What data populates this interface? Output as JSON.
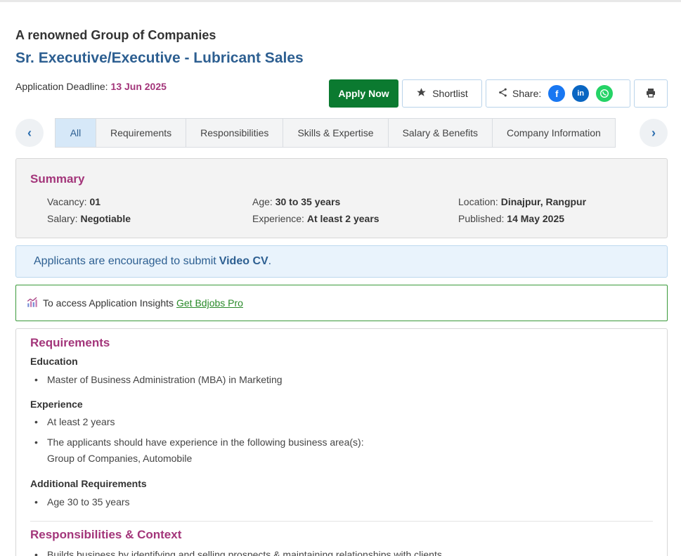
{
  "header": {
    "company": "A renowned Group of Companies",
    "title": "Sr. Executive/Executive - Lubricant Sales",
    "deadline_label": "Application Deadline:",
    "deadline_date": "13 Jun 2025"
  },
  "actions": {
    "apply": "Apply Now",
    "shortlist": "Shortlist",
    "share": "Share:"
  },
  "tabs": [
    "All",
    "Requirements",
    "Responsibilities",
    "Skills & Expertise",
    "Salary & Benefits",
    "Company Information"
  ],
  "summary": {
    "title": "Summary",
    "vacancy_label": "Vacancy:",
    "vacancy": "01",
    "age_label": "Age:",
    "age": "30 to 35 years",
    "location_label": "Location:",
    "location": "Dinajpur, Rangpur",
    "salary_label": "Salary:",
    "salary": "Negotiable",
    "experience_label": "Experience:",
    "experience": "At least 2 years",
    "published_label": "Published:",
    "published": "14 May 2025"
  },
  "notice": {
    "text": "Applicants are encouraged to submit",
    "bold": "Video CV",
    "end": "."
  },
  "insights": {
    "text": "To access Application Insights",
    "link": "Get Bdjobs Pro"
  },
  "requirements": {
    "title": "Requirements",
    "education_title": "Education",
    "education_items": [
      "Master of Business Administration (MBA) in Marketing"
    ],
    "experience_title": "Experience",
    "experience_item1": "At least 2 years",
    "experience_item2_line1": "The applicants should have experience in the following business area(s):",
    "experience_item2_line2": "Group of Companies, Automobile",
    "additional_title": "Additional Requirements",
    "additional_items": [
      "Age 30 to 35 years"
    ]
  },
  "responsibilities": {
    "title": "Responsibilities & Context",
    "first_item": "Builds business by identifying and selling prospects & maintaining relationships with clients."
  },
  "colors": {
    "accent_blue": "#2d5f91",
    "accent_magenta": "#a3357a",
    "apply_green": "#0b7a30"
  }
}
